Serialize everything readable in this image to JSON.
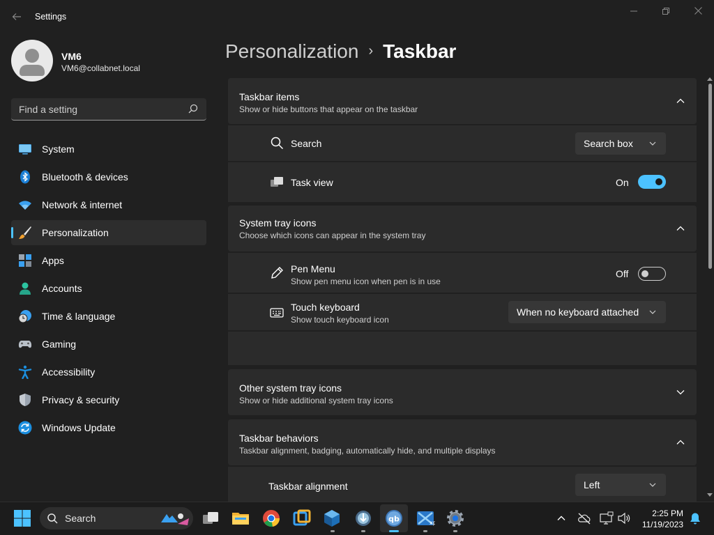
{
  "app": {
    "title": "Settings"
  },
  "profile": {
    "name": "VM6",
    "email": "VM6@collabnet.local"
  },
  "search": {
    "placeholder": "Find a setting"
  },
  "sidebar": {
    "items": [
      {
        "label": "System",
        "icon": "system-icon"
      },
      {
        "label": "Bluetooth & devices",
        "icon": "bluetooth-icon"
      },
      {
        "label": "Network & internet",
        "icon": "wifi-icon"
      },
      {
        "label": "Personalization",
        "icon": "brush-icon",
        "active": true
      },
      {
        "label": "Apps",
        "icon": "apps-icon"
      },
      {
        "label": "Accounts",
        "icon": "accounts-icon"
      },
      {
        "label": "Time & language",
        "icon": "clock-globe-icon"
      },
      {
        "label": "Gaming",
        "icon": "gamepad-icon"
      },
      {
        "label": "Accessibility",
        "icon": "accessibility-icon"
      },
      {
        "label": "Privacy & security",
        "icon": "shield-icon"
      },
      {
        "label": "Windows Update",
        "icon": "update-icon"
      }
    ]
  },
  "breadcrumb": {
    "parent": "Personalization",
    "separator": "›",
    "current": "Taskbar"
  },
  "sections": {
    "taskbar_items": {
      "title": "Taskbar items",
      "subtitle": "Show or hide buttons that appear on the taskbar",
      "expanded": true,
      "search": {
        "label": "Search",
        "value": "Search box"
      },
      "task_view": {
        "label": "Task view",
        "state": "On"
      }
    },
    "system_tray": {
      "title": "System tray icons",
      "subtitle": "Choose which icons can appear in the system tray",
      "expanded": true,
      "pen_menu": {
        "label": "Pen Menu",
        "sub": "Show pen menu icon when pen is in use",
        "state": "Off"
      },
      "touch_keyboard": {
        "label": "Touch keyboard",
        "sub": "Show touch keyboard icon",
        "value": "When no keyboard attached"
      }
    },
    "other_tray": {
      "title": "Other system tray icons",
      "subtitle": "Show or hide additional system tray icons",
      "expanded": false
    },
    "behaviors": {
      "title": "Taskbar behaviors",
      "subtitle": "Taskbar alignment, badging, automatically hide, and multiple displays",
      "expanded": true,
      "alignment": {
        "label": "Taskbar alignment",
        "value": "Left"
      }
    }
  },
  "taskbar": {
    "search_label": "Search",
    "apps": [
      "task-view-icon",
      "file-explorer-icon",
      "chrome-icon",
      "app-icon",
      "virtualbox-icon",
      "installer-icon",
      "qbittorrent-icon",
      "xp-mode-icon",
      "settings-icon"
    ],
    "time": "2:25 PM",
    "date": "11/19/2023"
  },
  "colors": {
    "accent": "#4cc2ff",
    "background": "#202020",
    "card": "#2b2b2b"
  }
}
